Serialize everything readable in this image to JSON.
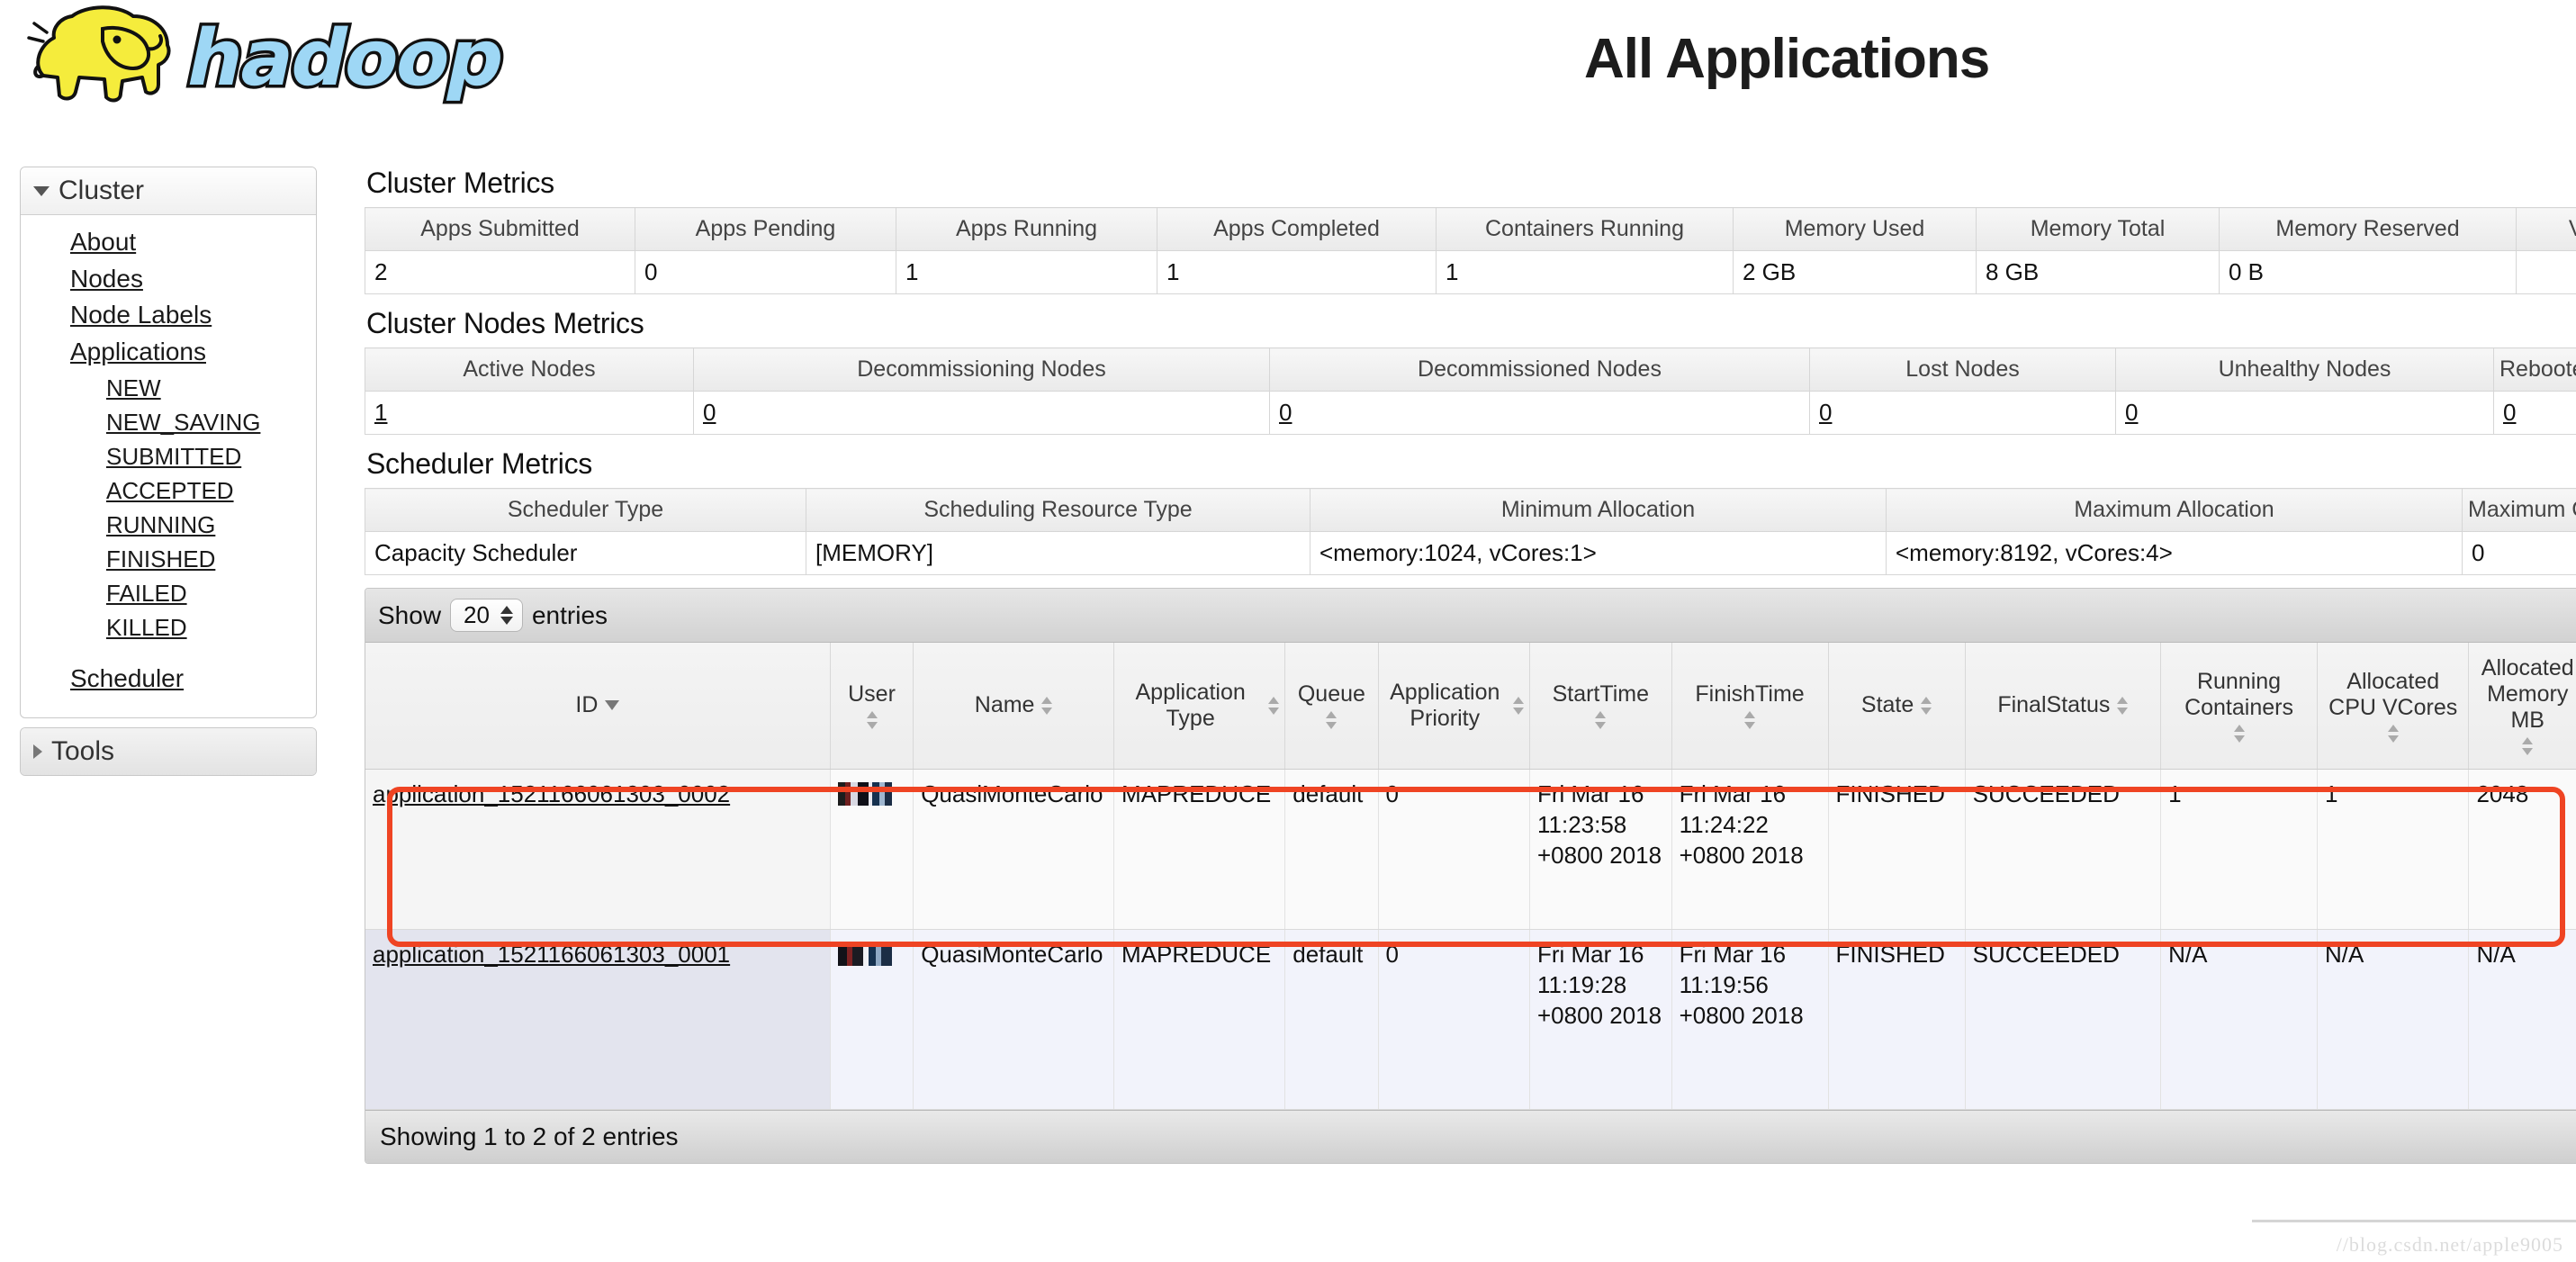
{
  "header": {
    "logo_alt": "hadoop-logo",
    "logo_word": "hadoop",
    "title": "All Applications"
  },
  "sidebar": {
    "cluster": {
      "label": "Cluster",
      "expanded": true,
      "links": [
        {
          "label": "About",
          "level": 1
        },
        {
          "label": "Nodes",
          "level": 1
        },
        {
          "label": "Node Labels",
          "level": 1
        },
        {
          "label": "Applications",
          "level": 1
        },
        {
          "label": "NEW",
          "level": 2
        },
        {
          "label": "NEW_SAVING",
          "level": 2
        },
        {
          "label": "SUBMITTED",
          "level": 2
        },
        {
          "label": "ACCEPTED",
          "level": 2
        },
        {
          "label": "RUNNING",
          "level": 2
        },
        {
          "label": "FINISHED",
          "level": 2
        },
        {
          "label": "FAILED",
          "level": 2
        },
        {
          "label": "KILLED",
          "level": 2
        },
        {
          "label": "Scheduler",
          "level": 1,
          "gap_before": true
        }
      ]
    },
    "tools": {
      "label": "Tools",
      "expanded": false
    }
  },
  "cluster_metrics": {
    "title": "Cluster Metrics",
    "columns": [
      "Apps Submitted",
      "Apps Pending",
      "Apps Running",
      "Apps Completed",
      "Containers Running",
      "Memory Used",
      "Memory Total",
      "Memory Reserved",
      "VCores"
    ],
    "values": [
      "2",
      "0",
      "1",
      "1",
      "1",
      "2 GB",
      "8 GB",
      "0 B",
      ""
    ]
  },
  "cluster_nodes_metrics": {
    "title": "Cluster Nodes Metrics",
    "columns": [
      "Active Nodes",
      "Decommissioning Nodes",
      "Decommissioned Nodes",
      "Lost Nodes",
      "Unhealthy Nodes",
      "Rebooted Nodes"
    ],
    "values": [
      "1",
      "0",
      "0",
      "0",
      "0",
      "0"
    ]
  },
  "scheduler_metrics": {
    "title": "Scheduler Metrics",
    "columns": [
      "Scheduler Type",
      "Scheduling Resource Type",
      "Minimum Allocation",
      "Maximum Allocation",
      "Maximum Cluster Application Priority"
    ],
    "values": [
      "Capacity Scheduler",
      "[MEMORY]",
      "<memory:1024, vCores:1>",
      "<memory:8192, vCores:4>",
      "0"
    ]
  },
  "apps_table": {
    "show_label": "Show",
    "entries_label": "entries",
    "page_size": "20",
    "columns": [
      {
        "label": "ID",
        "sort": "desc"
      },
      {
        "label": "User",
        "sort": "both"
      },
      {
        "label": "Name",
        "sort": "both"
      },
      {
        "label": "Application Type",
        "sort": "both"
      },
      {
        "label": "Queue",
        "sort": "both"
      },
      {
        "label": "Application Priority",
        "sort": "both"
      },
      {
        "label": "StartTime",
        "sort": "both"
      },
      {
        "label": "FinishTime",
        "sort": "both"
      },
      {
        "label": "State",
        "sort": "both"
      },
      {
        "label": "FinalStatus",
        "sort": "both"
      },
      {
        "label": "Running Containers",
        "sort": "both"
      },
      {
        "label": "Allocated CPU VCores",
        "sort": "both"
      },
      {
        "label": "Allocated Memory MB",
        "sort": "both"
      }
    ],
    "rows": [
      {
        "id": "application_1521166061303_0002",
        "user": "redacted",
        "name": "QuasiMonteCarlo",
        "type": "MAPREDUCE",
        "queue": "default",
        "priority": "0",
        "start_time": "Fri Mar 16 11:23:58 +0800 2018",
        "finish_time": "Fri Mar 16 11:24:22 +0800 2018",
        "state": "FINISHED",
        "final_status": "SUCCEEDED",
        "running_containers": "1",
        "allocated_vcores": "1",
        "allocated_memory": "2048"
      },
      {
        "id": "application_1521166061303_0001",
        "user": "redacted",
        "name": "QuasiMonteCarlo",
        "type": "MAPREDUCE",
        "queue": "default",
        "priority": "0",
        "start_time": "Fri Mar 16 11:19:28 +0800 2018",
        "finish_time": "Fri Mar 16 11:19:56 +0800 2018",
        "state": "FINISHED",
        "final_status": "SUCCEEDED",
        "running_containers": "N/A",
        "allocated_vcores": "N/A",
        "allocated_memory": "N/A"
      }
    ],
    "footer": "Showing 1 to 2 of 2 entries"
  },
  "annotation": {
    "color": "#ef4423",
    "shape": "rounded-rect",
    "target_row_index": 0
  },
  "watermark": "//blog.csdn.net/apple9005"
}
